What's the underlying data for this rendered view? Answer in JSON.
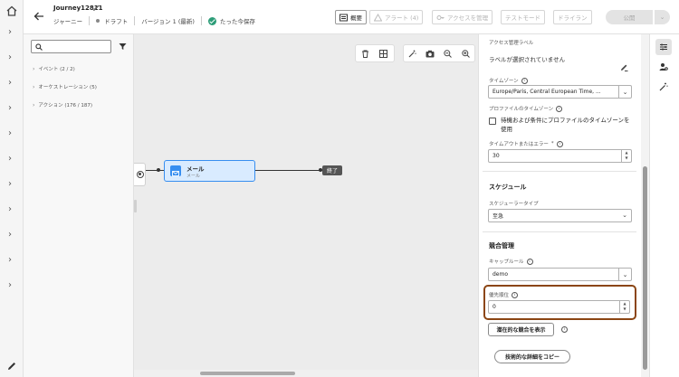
{
  "header": {
    "journey_title": "Journey12811",
    "breadcrumb_journey": "ジャーニー",
    "status": "ドラフト",
    "version": "バージョン 1 (最新)",
    "save_status": "たった今保存",
    "buttons": {
      "summary": "概要",
      "alerts": "アラート (4)",
      "access": "アクセスを管理",
      "test_mode": "テストモード",
      "dry_run": "ドライラン",
      "publish": "公開"
    }
  },
  "left_panel": {
    "search_placeholder": "",
    "categories": [
      {
        "label": "イベント (2 / 2)"
      },
      {
        "label": "オーケストレーション (5)"
      },
      {
        "label": "アクション (176 / 187)"
      }
    ]
  },
  "canvas": {
    "mail_node_title": "メール",
    "mail_node_sub": "メール",
    "end_node": "終了"
  },
  "properties": {
    "access_label_title": "アクセス管理ラベル",
    "no_label_selected": "ラベルが選択されていません",
    "timezone_label": "タイムゾーン",
    "timezone_value": "Europe/Paris, Central European Time, ...",
    "profile_tz_label": "プロファイルのタイムゾーン",
    "profile_tz_checkbox": "待機および条件にプロファイルのタイムゾーンを使用",
    "timeout_label": "タイムアウトまたはエラー",
    "timeout_required": "*",
    "timeout_value": "30",
    "schedule_title": "スケジュール",
    "scheduler_type_label": "スケジューラータイプ",
    "scheduler_type_value": "至急",
    "conflict_title": "競合管理",
    "capping_rule_label": "キャップルール",
    "capping_rule_value": "demo",
    "priority_label": "優先順位",
    "priority_value": "0",
    "potential_conflicts_button": "潜在的な競合を表示",
    "copy_details_button": "技術的な詳細をコピー"
  },
  "colors": {
    "accent": "#378ef0",
    "mail_node_bg": "#d9ebff",
    "success": "#2d9d78",
    "focus_outline": "#8b4513"
  }
}
